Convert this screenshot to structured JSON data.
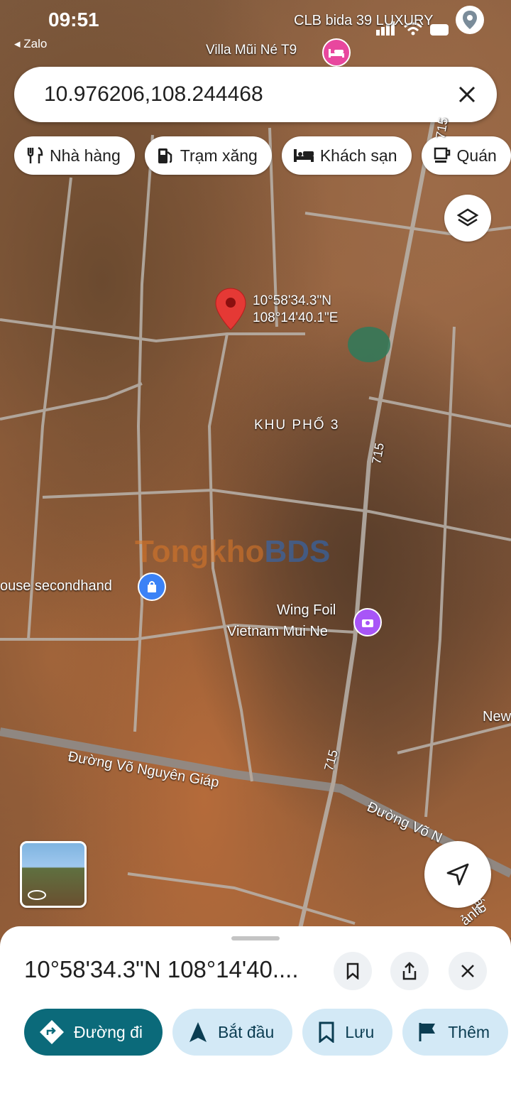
{
  "status": {
    "time": "09:51",
    "back_app": "◂ Zalo"
  },
  "map": {
    "top_poi": "CLB bida 39 LUXURY",
    "villa": "Villa Mũi Né T9",
    "pin_lat": "10°58'34.3\"N",
    "pin_lng": "108°14'40.1\"E",
    "area_label": "KHU PHỐ 3",
    "road_715": "715",
    "watermark_a": "Tongkho",
    "watermark_b": "BDS",
    "poi_secondhand": "ouse secondhand",
    "poi_wing_1": "Wing Foil",
    "poi_wing_2": "Vietnam Mui Ne",
    "poi_new": "New",
    "street_1": "Đường Võ Nguyên Giáp",
    "street_2": "Đường Võ N",
    "street_2b": "giáp",
    "street_3": "ảnh"
  },
  "search": {
    "value": "10.976206,108.244468"
  },
  "chips": [
    {
      "label": "Nhà hàng",
      "icon": "restaurant-icon"
    },
    {
      "label": "Trạm xăng",
      "icon": "gas-station-icon"
    },
    {
      "label": "Khách sạn",
      "icon": "hotel-icon"
    },
    {
      "label": "Quán",
      "icon": "cafe-icon"
    }
  ],
  "sheet": {
    "title": "10°58'34.3\"N 108°14'40....",
    "actions": {
      "directions": "Đường đi",
      "start": "Bắt đầu",
      "save": "Lưu",
      "more": "Thêm"
    }
  },
  "colors": {
    "accent": "#0b6a7a",
    "pin": "#e53935",
    "chip_bg": "#d3e9f6"
  }
}
